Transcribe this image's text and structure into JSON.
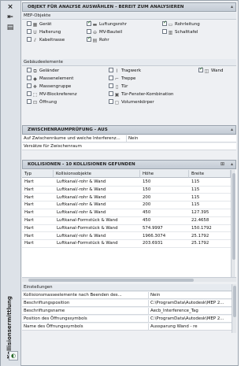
{
  "sidebar": {
    "close_icon": "×",
    "pin_icon": "⇤",
    "menu_icon": "▤",
    "title": "Kollisionsermittlung"
  },
  "header1": {
    "title": "OBJEKT FÜR ANALYSE AUSWÄHLEN - BEREIT ZUM ANALYSIEREN"
  },
  "mep": {
    "title": "MEP-Objekte",
    "items": [
      {
        "label": "Gerät",
        "checked": false
      },
      {
        "label": "Luftungsrohr",
        "checked": true
      },
      {
        "label": "Rohrleitung",
        "checked": true
      },
      {
        "label": "Halterung",
        "checked": false
      },
      {
        "label": "MV-Bauteil",
        "checked": false
      },
      {
        "label": "Schalttafel",
        "checked": false
      },
      {
        "label": "Kabeltrasse",
        "checked": false
      },
      {
        "label": "Rohr",
        "checked": true
      }
    ]
  },
  "building": {
    "title": "Gebäudeelemente",
    "items": [
      {
        "label": "Geländer",
        "checked": false
      },
      {
        "label": "Tragwerk",
        "checked": false
      },
      {
        "label": "Wand",
        "checked": true
      },
      {
        "label": "Massenelement",
        "checked": false
      },
      {
        "label": "Treppe",
        "checked": false
      },
      {
        "label": "Massengruppe",
        "checked": false
      },
      {
        "label": "Tür",
        "checked": false
      },
      {
        "label": "MV-Blockreferenz",
        "checked": false
      },
      {
        "label": "Tür-Fenster-Kombination",
        "checked": false
      },
      {
        "label": "Öffnung",
        "checked": false
      },
      {
        "label": "Volumenkörper",
        "checked": false
      }
    ]
  },
  "header2": {
    "title": "ZWISCHENRAUMPRÜFUNG - AUS"
  },
  "clearance": {
    "rows": [
      {
        "key": "Auf Zwischenräume und weiche Interferenz...",
        "value": "Nein"
      },
      {
        "key": "Versätze für Zwischenraum",
        "value": ""
      }
    ]
  },
  "header3": {
    "title": "KOLLISIONEN - 10 KOLLISIONEN GEFUNDEN"
  },
  "collisions": {
    "columns": [
      "Typ",
      "Kollisionsobjekte",
      "Höhe",
      "Breite"
    ],
    "rows": [
      [
        "Hart",
        "Luftkanal/-rohr & Wand",
        "150",
        "115"
      ],
      [
        "Hart",
        "Luftkanal/-rohr & Wand",
        "150",
        "115"
      ],
      [
        "Hart",
        "Luftkanal/-rohr & Wand",
        "200",
        "115"
      ],
      [
        "Hart",
        "Luftkanal/-rohr & Wand",
        "200",
        "115"
      ],
      [
        "Hart",
        "Luftkanal/-rohr & Wand",
        "450",
        "127.395"
      ],
      [
        "Hart",
        "Luftkanal-Formstück & Wand",
        "450",
        "22.4658"
      ],
      [
        "Hart",
        "Luftkanal-Formstück & Wand",
        "574.9997",
        "150.1792"
      ],
      [
        "Hart",
        "Luftkanal/-rohr & Wand",
        "1966.3074",
        "25.1792"
      ],
      [
        "Hart",
        "Luftkanal-Formstück & Wand",
        "203.6931",
        "25.1792"
      ]
    ]
  },
  "settings": {
    "title": "Einstellungen",
    "rows": [
      {
        "key": "Kollisionsmasseelemente nach Beenden des...",
        "value": "Nein"
      },
      {
        "key": "Beschriftungsposition",
        "value": "C:\\ProgramData\\Autodesk\\MEP 2..."
      },
      {
        "key": "Beschriftungsname",
        "value": "Aecb_Interference_Tag"
      },
      {
        "key": "Position des Öffnungssymbols",
        "value": "C:\\ProgramData\\Autodesk\\MEP 2..."
      },
      {
        "key": "Name des Öffnungssymbols",
        "value": "Aussparung Wand - re"
      }
    ]
  },
  "colors": {
    "accent_check": "#1a6b1a",
    "header_bg": "#c3cbd5"
  }
}
